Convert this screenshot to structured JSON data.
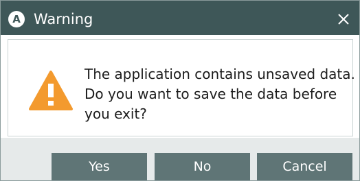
{
  "window": {
    "title": "Warning",
    "app_badge": "A",
    "close_icon": "close-icon"
  },
  "dialog": {
    "icon": "warning-triangle-icon",
    "message_lines": [
      "The application contains unsaved data.",
      "Do you want to save the data before",
      "you exit?"
    ]
  },
  "buttons": {
    "yes": "Yes",
    "no": "No",
    "cancel": "Cancel"
  },
  "colors": {
    "titlebar": "#3e5758",
    "button": "#5f7576",
    "warning": "#f39a2e"
  }
}
